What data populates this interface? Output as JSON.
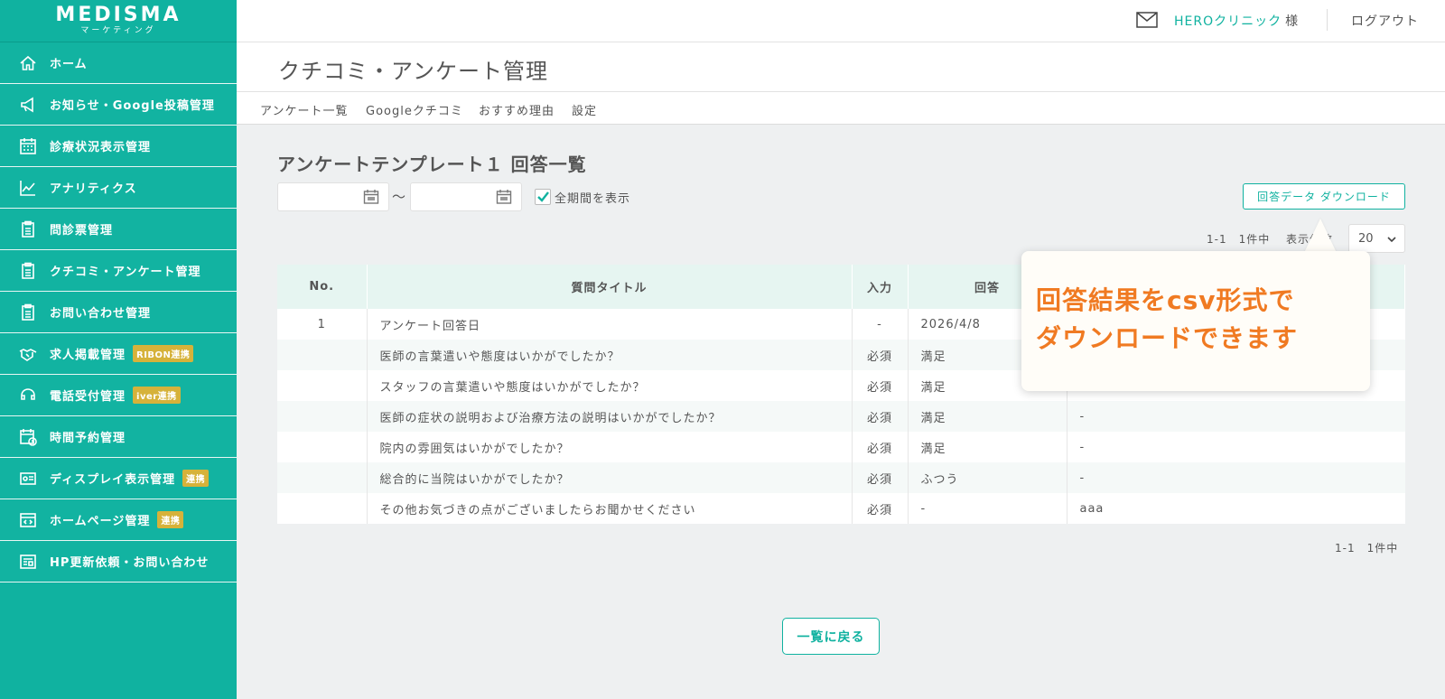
{
  "brand": {
    "name": "MEDISMA",
    "sub": "マーケティング"
  },
  "sidebar": {
    "items": [
      {
        "label": "ホーム",
        "icon": "home-icon"
      },
      {
        "label": "お知らせ・Google投稿管理",
        "icon": "megaphone-icon"
      },
      {
        "label": "診療状況表示管理",
        "icon": "calendar-grid-icon"
      },
      {
        "label": "アナリティクス",
        "icon": "chart-line-icon"
      },
      {
        "label": "問診票管理",
        "icon": "clipboard-icon"
      },
      {
        "label": "クチコミ・アンケート管理",
        "icon": "clipboard-icon"
      },
      {
        "label": "お問い合わせ管理",
        "icon": "clipboard-icon"
      },
      {
        "label": "求人掲載管理",
        "icon": "handshake-icon",
        "badge": "RIBON連携"
      },
      {
        "label": "電話受付管理",
        "icon": "phone-icon",
        "badge": "iver連携"
      },
      {
        "label": "時間予約管理",
        "icon": "calendar-clock-icon"
      },
      {
        "label": "ディスプレイ表示管理",
        "icon": "id-card-icon",
        "badge": "連携"
      },
      {
        "label": "ホームページ管理",
        "icon": "code-window-icon",
        "badge": "連携"
      },
      {
        "label": "HP更新依頼・お問い合わせ",
        "icon": "news-icon"
      }
    ]
  },
  "header": {
    "clinic": "HEROクリニック",
    "honorific": "様",
    "logout": "ログアウト"
  },
  "page": {
    "title": "クチコミ・アンケート管理"
  },
  "tabs": [
    "アンケート一覧",
    "Googleクチコミ",
    "おすすめ理由",
    "設定"
  ],
  "content": {
    "section_title": "アンケートテンプレート１ 回答一覧",
    "tilde": "〜",
    "all_period": "全期間を表示",
    "download": "回答データ ダウンロード",
    "pager": "1-1　1件中",
    "per_page_label": "表示件数",
    "per_page_value": "20",
    "back": "一覧に戻る"
  },
  "table": {
    "headers": [
      "No.",
      "質問タイトル",
      "入力",
      "回答",
      ""
    ],
    "rows": [
      {
        "no": "1",
        "title": "アンケート回答日",
        "input": "-",
        "answer": "2026/4/8",
        "extra": ""
      },
      {
        "no": "",
        "title": "医師の言葉遣いや態度はいかがでしたか？",
        "input": "必須",
        "answer": "満足",
        "extra": ""
      },
      {
        "no": "",
        "title": "スタッフの言葉遣いや態度はいかがでしたか？",
        "input": "必須",
        "answer": "満足",
        "extra": ""
      },
      {
        "no": "",
        "title": "医師の症状の説明および治療方法の説明はいかがでしたか？",
        "input": "必須",
        "answer": "満足",
        "extra": "-"
      },
      {
        "no": "",
        "title": "院内の雰囲気はいかがでしたか？",
        "input": "必須",
        "answer": "満足",
        "extra": "-"
      },
      {
        "no": "",
        "title": "総合的に当院はいかがでしたか？",
        "input": "必須",
        "answer": "ふつう",
        "extra": "-"
      },
      {
        "no": "",
        "title": "その他お気づきの点がございましたらお聞かせください",
        "input": "必須",
        "answer": "-",
        "extra": "aaa"
      }
    ]
  },
  "callout": {
    "line1": "回答結果をcsv形式で",
    "line2": "ダウンロードできます"
  },
  "colors": {
    "accent": "#10b2a0",
    "callout_text": "#f07a22",
    "badge": "#d6b23a"
  }
}
